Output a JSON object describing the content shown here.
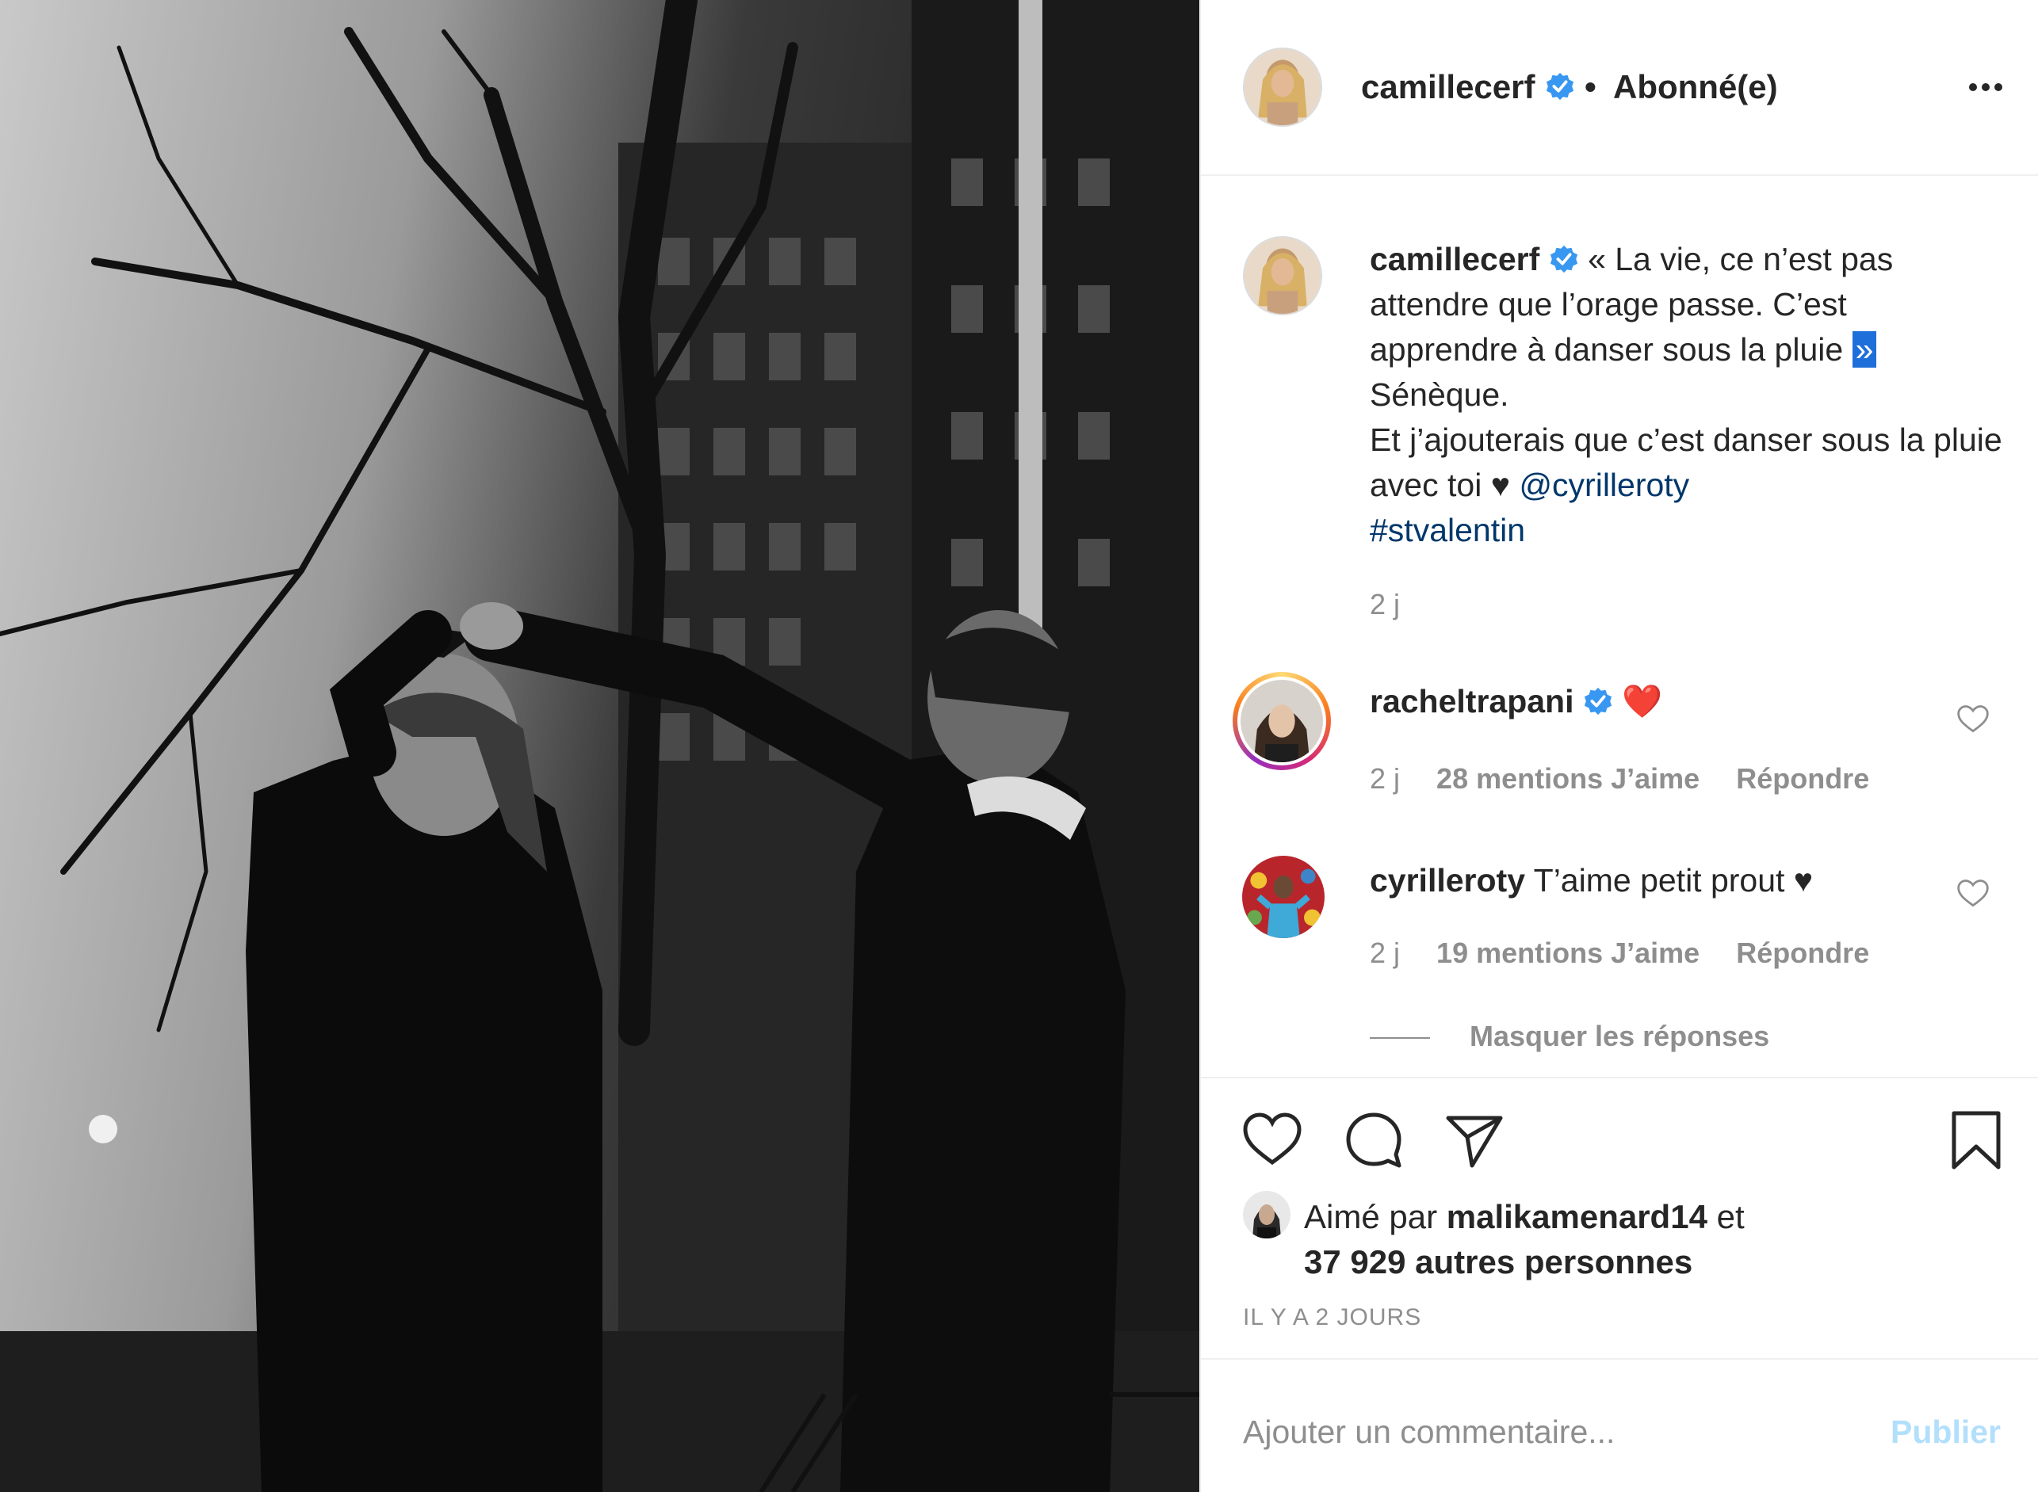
{
  "post": {
    "photo_description_icon": "photo-couple-dancing-icon"
  },
  "header": {
    "username": "camillecerf",
    "separator": "•",
    "follow_status": "Abonné(e)"
  },
  "caption": {
    "username": "camillecerf",
    "text_part1": "« La vie, ce n’est pas attendre que l’orage passe. C’est apprendre à danser sous la pluie ",
    "text_selected": "»",
    "text_line_author": "Sénèque.",
    "text_part2": "Et j’ajouterais que c’est danser sous la pluie avec toi ♥ ",
    "mention": "@cyrilleroty",
    "hashtag": "#stvalentin",
    "time": "2 j"
  },
  "comments": [
    {
      "username": "racheltrapani",
      "text": "❤️",
      "time": "2 j",
      "likes": "28 mentions J’aime",
      "reply": "Répondre"
    },
    {
      "username": "cyrilleroty",
      "text": "T’aime petit prout ♥",
      "time": "2 j",
      "likes": "19 mentions J’aime",
      "reply": "Répondre"
    }
  ],
  "hide_replies": "Masquer les réponses",
  "likes": {
    "prefix": "Aimé par",
    "user": "malikamenard14",
    "conj": "et",
    "others": "37 929 autres personnes"
  },
  "date": "IL Y A 2 JOURS",
  "add_comment": {
    "placeholder": "Ajouter un commentaire...",
    "post_label": "Publier"
  },
  "colors": {
    "verified": "#3897f0",
    "link": "#00376b",
    "muted": "#8e8e8e",
    "post_disabled": "#b2dffc",
    "heart_red": "#ed4956"
  }
}
